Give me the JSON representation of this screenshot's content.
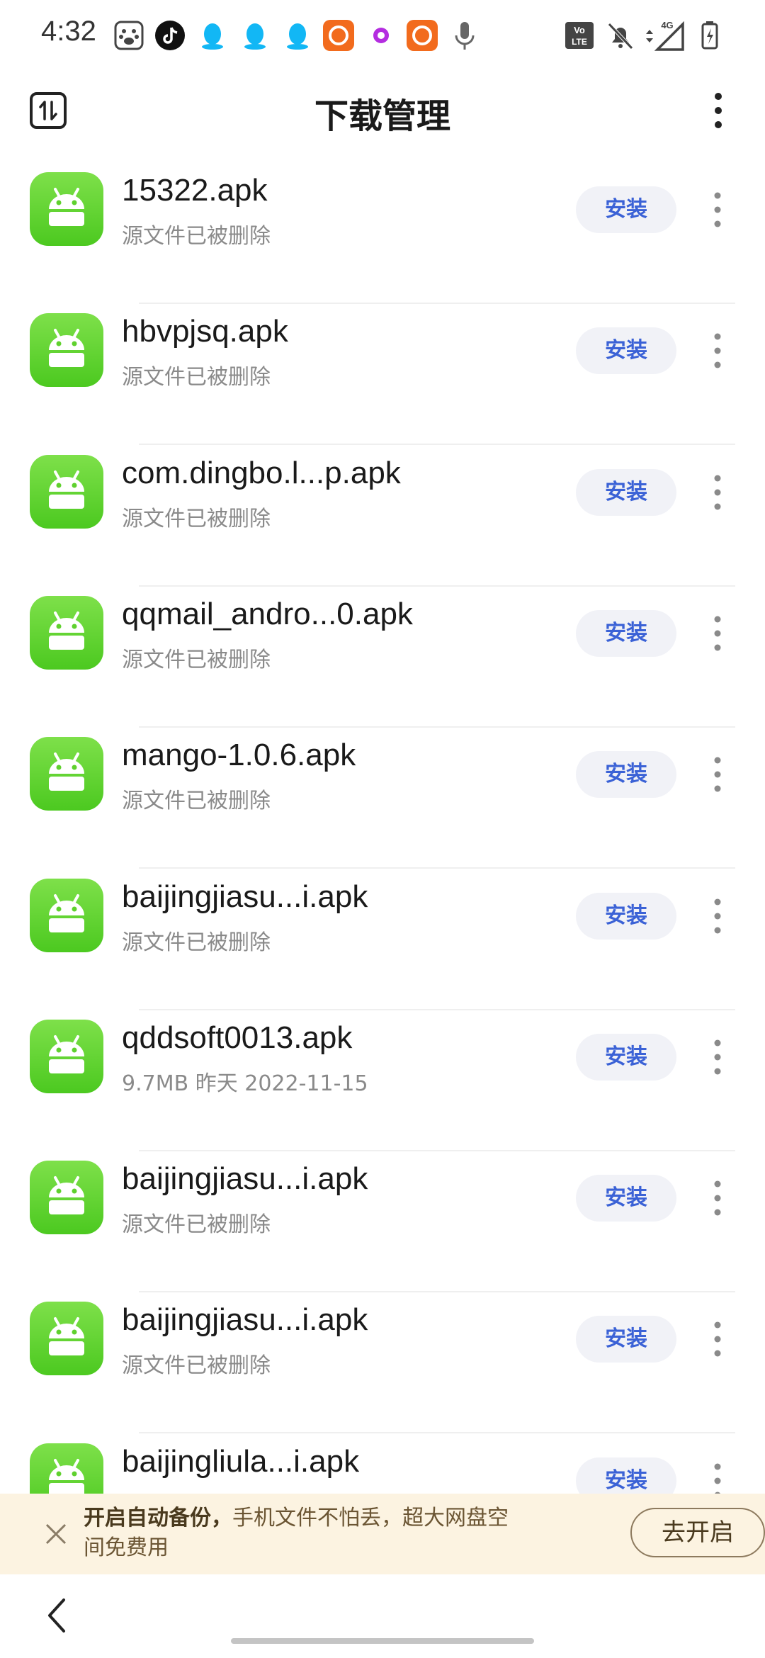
{
  "status_bar": {
    "time": "4:32",
    "left_icons": [
      "baidu-icon",
      "tiktok-icon",
      "qq-icon",
      "qq-icon",
      "qq-icon",
      "app-icon-orange",
      "dot-icon-purple",
      "app-icon-orange",
      "microphone-icon"
    ],
    "right_icons": [
      "volte-icon",
      "mute-bell-icon",
      "signal-4g-icon",
      "battery-charging-icon"
    ],
    "network_label": "4G",
    "volte_label": "Vo LTE"
  },
  "header": {
    "title": "下载管理",
    "left_icon": "sort-toggle-icon",
    "right_icon": "more-vertical-icon"
  },
  "files": [
    {
      "name": "15322.apk",
      "status": "源文件已被删除",
      "action": "安装"
    },
    {
      "name": "hbvpjsq.apk",
      "status": "源文件已被删除",
      "action": "安装"
    },
    {
      "name": "com.dingbo.l...p.apk",
      "status": "源文件已被删除",
      "action": "安装"
    },
    {
      "name": "qqmail_andro...0.apk",
      "status": "源文件已被删除",
      "action": "安装"
    },
    {
      "name": "mango-1.0.6.apk",
      "status": "源文件已被删除",
      "action": "安装"
    },
    {
      "name": "baijingjiasu...i.apk",
      "status": "源文件已被删除",
      "action": "安装"
    },
    {
      "name": "qddsoft0013.apk",
      "status": "9.7MB    昨天 2022-11-15",
      "action": "安装"
    },
    {
      "name": "baijingjiasu...i.apk",
      "status": "源文件已被删除",
      "action": "安装"
    },
    {
      "name": "baijingjiasu...i.apk",
      "status": "源文件已被删除",
      "action": "安装"
    },
    {
      "name": "baijingliula...i.apk",
      "status": "",
      "action": "安装"
    }
  ],
  "banner": {
    "bold_text": "开启自动备份，",
    "text": "手机文件不怕丢，超大网盘空间免费用",
    "button": "去开启",
    "close_icon": "close-icon"
  },
  "colors": {
    "accent": "#3b62d6",
    "app_icon_green": "#5fd12e",
    "banner_bg": "#fcf3e1"
  }
}
